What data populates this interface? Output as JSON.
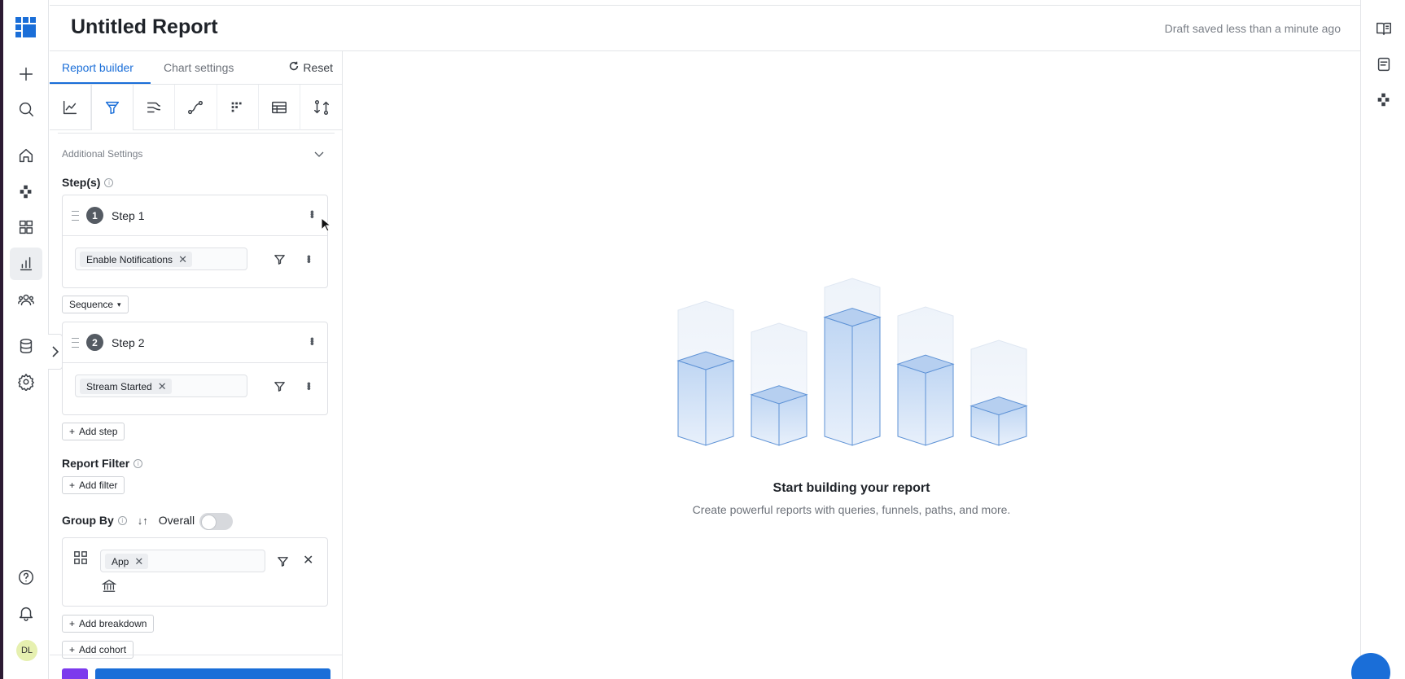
{
  "header": {
    "title": "Untitled Report",
    "draft_status": "Draft saved less than a minute ago"
  },
  "left_rail": {
    "avatar_initials": "DL",
    "items": [
      "logo-icon",
      "plus-icon",
      "search-icon",
      "home-icon",
      "apps-icon",
      "grid-icon",
      "bar-chart-icon",
      "users-icon",
      "database-icon",
      "settings-icon",
      "help-icon",
      "bell-icon"
    ]
  },
  "panel": {
    "tabs": [
      {
        "label": "Report builder",
        "active": true
      },
      {
        "label": "Chart settings",
        "active": false
      }
    ],
    "reset_label": "Reset",
    "chart_types": [
      "line-chart-icon",
      "funnel-icon",
      "flows-icon",
      "path-icon",
      "retention-icon",
      "table-icon",
      "compare-icon"
    ],
    "additional_settings_label": "Additional Settings",
    "steps_label": "Step(s)",
    "steps": [
      {
        "number": "1",
        "label": "Step 1",
        "event": "Enable Notifications"
      },
      {
        "number": "2",
        "label": "Step 2",
        "event": "Stream Started"
      }
    ],
    "sequence_label": "Sequence",
    "add_step_label": "Add step",
    "report_filter_label": "Report Filter",
    "add_filter_label": "Add filter",
    "group_by_label": "Group By",
    "overall_label": "Overall",
    "overall_enabled": false,
    "group_by_chip": "App",
    "add_breakdown_label": "Add breakdown",
    "add_cohort_label": "Add cohort"
  },
  "empty_state": {
    "title": "Start building your report",
    "subtitle": "Create powerful reports with queries, funnels, paths, and more."
  },
  "colors": {
    "accent": "#1a6ed8",
    "purple": "#7c3aed"
  }
}
